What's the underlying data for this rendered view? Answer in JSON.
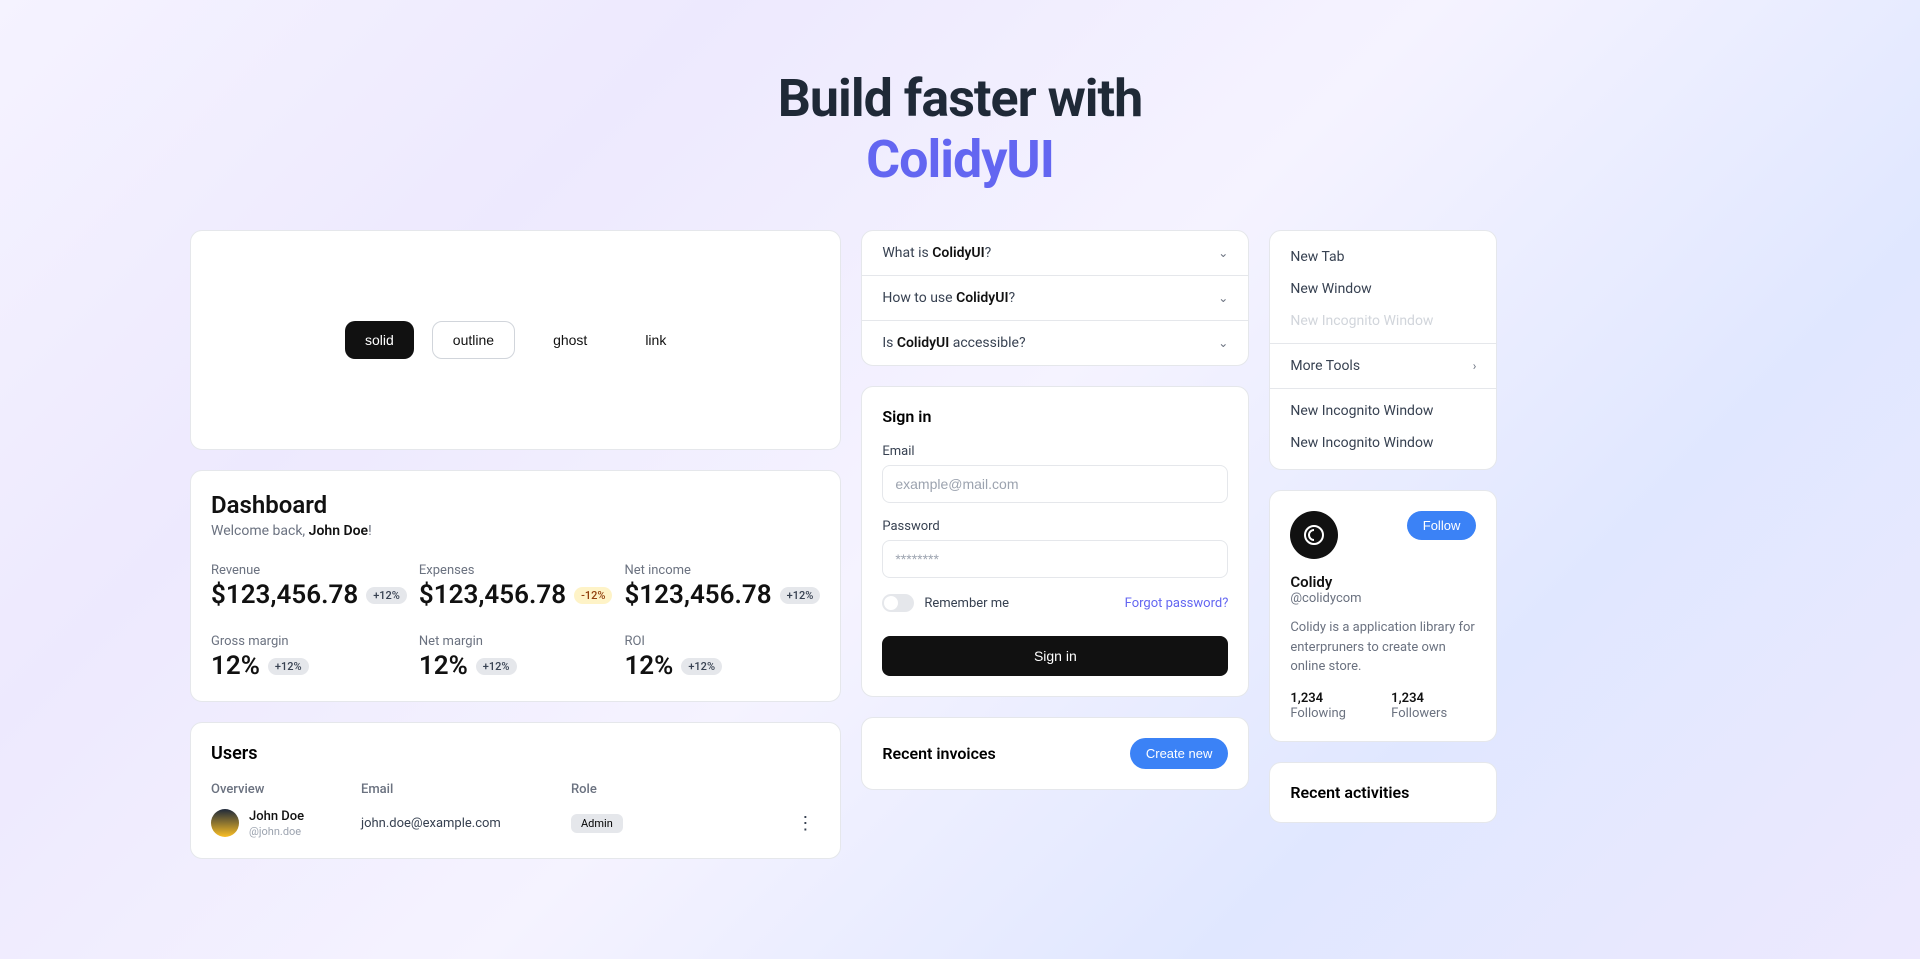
{
  "hero": {
    "title": "Build faster with",
    "brand": "ColidyUI"
  },
  "buttons": {
    "solid": "solid",
    "outline": "outline",
    "ghost": "ghost",
    "link": "link"
  },
  "dashboard": {
    "title": "Dashboard",
    "welcome_prefix": "Welcome back, ",
    "welcome_name": "John Doe",
    "welcome_suffix": "!",
    "stats": [
      {
        "label": "Revenue",
        "value": "$123,456.78",
        "delta": "+12%",
        "delta_type": "pos"
      },
      {
        "label": "Expenses",
        "value": "$123,456.78",
        "delta": "-12%",
        "delta_type": "neg"
      },
      {
        "label": "Net income",
        "value": "$123,456.78",
        "delta": "+12%",
        "delta_type": "pos"
      },
      {
        "label": "Gross margin",
        "value": "12%",
        "delta": "+12%",
        "delta_type": "pos"
      },
      {
        "label": "Net margin",
        "value": "12%",
        "delta": "+12%",
        "delta_type": "pos"
      },
      {
        "label": "ROI",
        "value": "12%",
        "delta": "+12%",
        "delta_type": "pos"
      }
    ]
  },
  "users": {
    "title": "Users",
    "headers": {
      "overview": "Overview",
      "email": "Email",
      "role": "Role"
    },
    "rows": [
      {
        "name": "John Doe",
        "handle": "@john.doe",
        "email": "john.doe@example.com",
        "role": "Admin"
      }
    ]
  },
  "accordion": {
    "items": [
      {
        "prefix": "What is ",
        "bold": "ColidyUI",
        "suffix": "?"
      },
      {
        "prefix": "How to use ",
        "bold": "ColidyUI",
        "suffix": "?"
      },
      {
        "prefix": "Is ",
        "bold": "ColidyUI",
        "suffix": " accessible?"
      }
    ]
  },
  "signin": {
    "title": "Sign in",
    "email_label": "Email",
    "email_placeholder": "example@mail.com",
    "password_label": "Password",
    "password_placeholder": "********",
    "remember": "Remember me",
    "forgot": "Forgot password?",
    "submit": "Sign in"
  },
  "invoices": {
    "title": "Recent invoices",
    "create": "Create new"
  },
  "menu": {
    "items": [
      {
        "label": "New Tab",
        "disabled": false
      },
      {
        "label": "New Window",
        "disabled": false
      },
      {
        "label": "New Incognito Window",
        "disabled": true
      }
    ],
    "more_tools": "More Tools",
    "bottom": [
      {
        "label": "New Incognito Window"
      },
      {
        "label": "New Incognito Window"
      }
    ]
  },
  "profile": {
    "name": "Colidy",
    "handle": "@colidycom",
    "follow": "Follow",
    "bio": "Colidy is a application library for enterpruners to create own online store.",
    "following_count": "1,234",
    "following_label": "Following",
    "followers_count": "1,234",
    "followers_label": "Followers",
    "avatar_initial": "C"
  },
  "activities": {
    "title": "Recent activities"
  }
}
